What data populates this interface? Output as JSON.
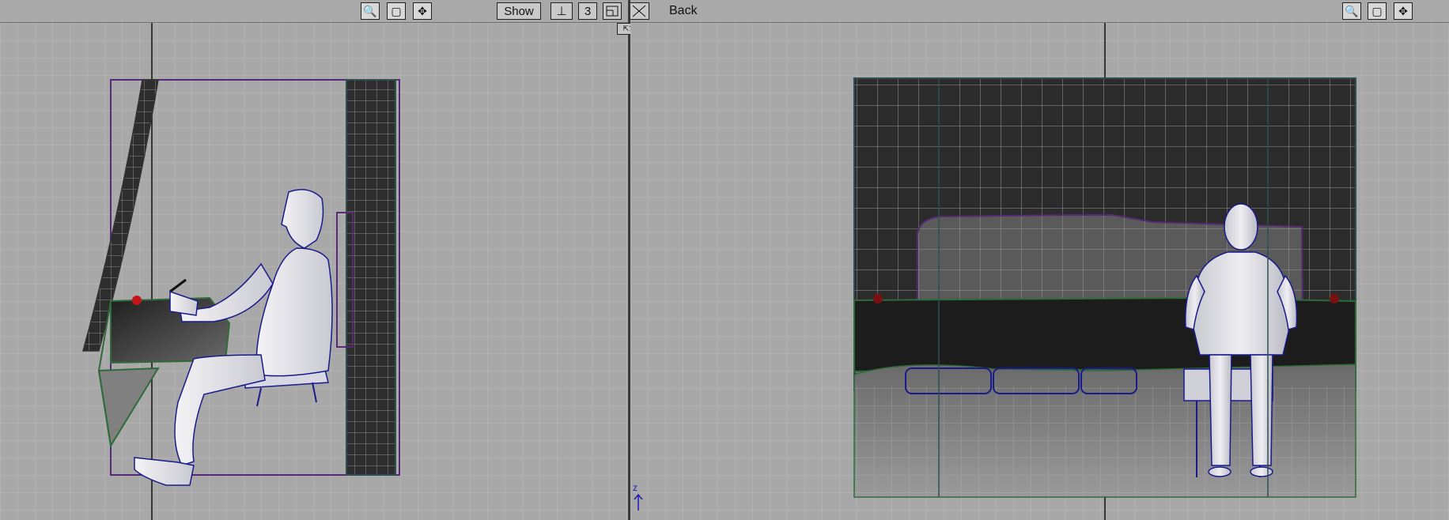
{
  "toolbar": {
    "left_icons": [
      {
        "icon": "zoom-icon",
        "glyph": "🔍"
      },
      {
        "icon": "fit-view-icon",
        "glyph": "▢"
      },
      {
        "icon": "pan-icon",
        "glyph": "✥"
      }
    ],
    "show_label": "Show",
    "ruler_glyph": "⊥",
    "number_label": "3",
    "back_label": "Back",
    "right_icons": [
      {
        "icon": "zoom-icon",
        "glyph": "🔍"
      },
      {
        "icon": "fit-view-icon",
        "glyph": "▢"
      },
      {
        "icon": "pan-icon",
        "glyph": "✥"
      }
    ]
  },
  "viewports": {
    "left": {
      "view": "side"
    },
    "right": {
      "view": "back"
    }
  },
  "axis_label": "z",
  "colors": {
    "background": "#a8a8a8",
    "grid": "#bcbcbc",
    "panel_dark": "#2e2e2e",
    "outline_purple": "#5a2a7a",
    "outline_green": "#2f6b3a",
    "wire_blue": "#1a1a8a"
  }
}
